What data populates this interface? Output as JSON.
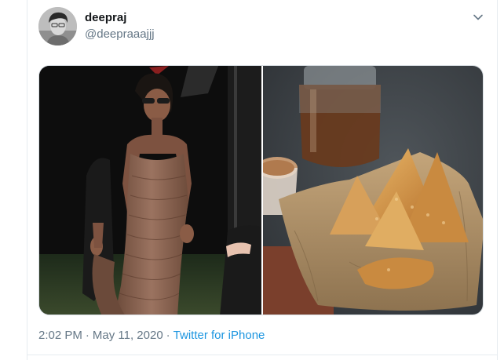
{
  "tweet": {
    "display_name": "deepraj",
    "handle": "@deepraaajjj",
    "time": "2:02 PM",
    "separator": "·",
    "date": "May 11, 2020",
    "source": "Twitter for iPhone",
    "icons": {
      "avatar": "avatar-photo",
      "menu": "chevron-down-icon"
    },
    "media": [
      {
        "name": "photo-person-brown-dress"
      },
      {
        "name": "photo-samosas-in-paper-bag"
      }
    ]
  },
  "colors": {
    "name": "#14171a",
    "secondary": "#657786",
    "link": "#1b95e0",
    "border": "#e6ecf0"
  }
}
